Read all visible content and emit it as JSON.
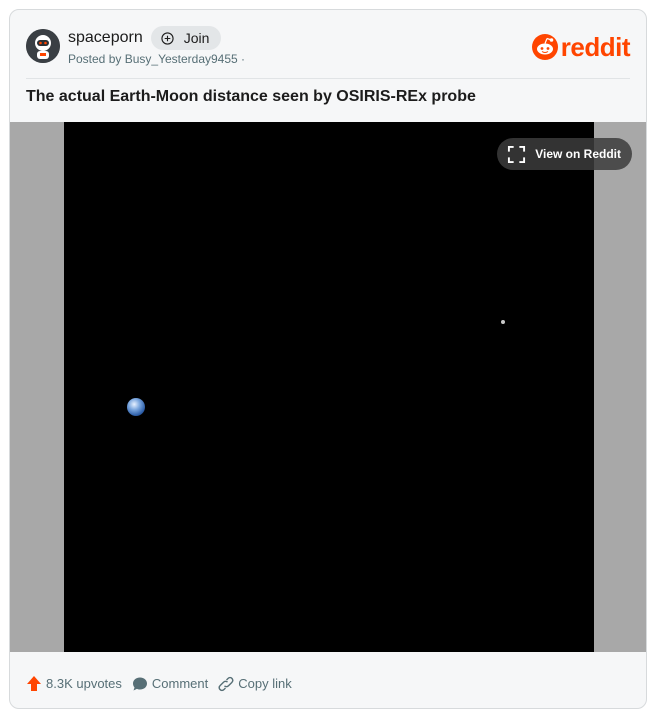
{
  "header": {
    "subreddit_name": "spaceporn",
    "join_label": "Join",
    "posted_by_prefix": "Posted by",
    "author": "Busy_Yesterday9455",
    "separator": "·",
    "brand_wordmark": "reddit",
    "brand_color": "#ff4500"
  },
  "post": {
    "title": "The actual Earth-Moon distance seen by OSIRIS-REx probe"
  },
  "media": {
    "view_button_label": "View on Reddit"
  },
  "footer": {
    "upvotes": "8.3K upvotes",
    "comment_label": "Comment",
    "copy_link_label": "Copy link"
  },
  "icons": {
    "avatar": "spaceporn-astronaut-avatar",
    "join": "plus-circle-icon",
    "logo": "reddit-snoo-icon",
    "expand": "fullscreen-expand-icon",
    "upvote": "upvote-arrow-icon",
    "comment": "comment-bubble-icon",
    "link": "link-chain-icon"
  }
}
